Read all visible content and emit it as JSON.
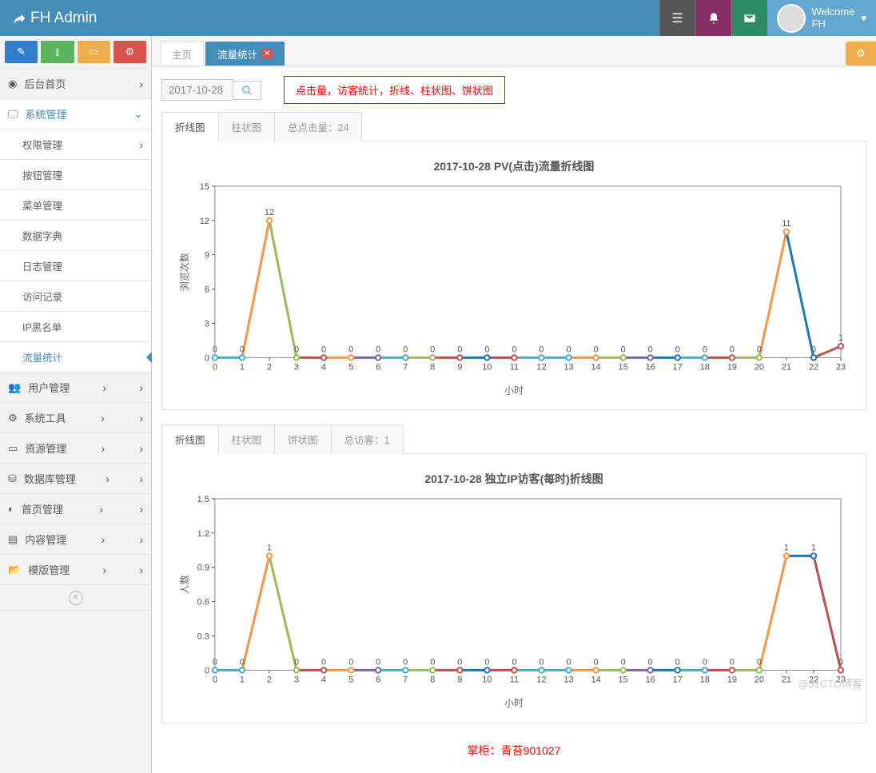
{
  "brand": "FH Admin",
  "welcome": {
    "label": "Welcome",
    "name": "FH"
  },
  "sidebar": {
    "items": [
      {
        "label": "后台首页"
      },
      {
        "label": "系统管理",
        "open": true,
        "children": [
          {
            "label": "权限管理",
            "arr": true
          },
          {
            "label": "按钮管理"
          },
          {
            "label": "菜单管理"
          },
          {
            "label": "数据字典"
          },
          {
            "label": "日志管理"
          },
          {
            "label": "访问记录"
          },
          {
            "label": "IP黑名单"
          },
          {
            "label": "流量统计",
            "active": true
          }
        ]
      },
      {
        "label": "用户管理"
      },
      {
        "label": "系统工具"
      },
      {
        "label": "资源管理"
      },
      {
        "label": "数据库管理"
      },
      {
        "label": "首页管理"
      },
      {
        "label": "内容管理"
      },
      {
        "label": "模版管理"
      }
    ]
  },
  "tabs": {
    "home": "主页",
    "active": "流量统计"
  },
  "date": "2017-10-28",
  "redbox": "点击量，访客统计，折线、柱状图、饼状图",
  "chart1": {
    "tabs": [
      "折线图",
      "柱状图"
    ],
    "total": "总点击量：24"
  },
  "chart2": {
    "tabs": [
      "折线图",
      "柱状图",
      "饼状图"
    ],
    "total": "总访客：1"
  },
  "footer": "掌柜：青苔901027",
  "watermark": "@51CTO博客",
  "chart_data": [
    {
      "type": "line",
      "title": "2017-10-28  PV(点击)流量折线图",
      "xlabel": "小时",
      "ylabel": "浏览次数",
      "categories": [
        "0",
        "1",
        "2",
        "3",
        "4",
        "5",
        "6",
        "7",
        "8",
        "9",
        "10",
        "11",
        "12",
        "13",
        "14",
        "15",
        "16",
        "17",
        "18",
        "19",
        "20",
        "21",
        "22",
        "23"
      ],
      "values": [
        0,
        0,
        12,
        0,
        0,
        0,
        0,
        0,
        0,
        0,
        0,
        0,
        0,
        0,
        0,
        0,
        0,
        0,
        0,
        0,
        0,
        11,
        0,
        1
      ],
      "ylim": [
        0,
        15
      ],
      "yticks": [
        0,
        3,
        6,
        9,
        12,
        15
      ]
    },
    {
      "type": "line",
      "title": "2017-10-28  独立IP访客(每时)折线图",
      "xlabel": "小时",
      "ylabel": "人数",
      "categories": [
        "0",
        "1",
        "2",
        "3",
        "4",
        "5",
        "6",
        "7",
        "8",
        "9",
        "10",
        "11",
        "12",
        "13",
        "14",
        "15",
        "16",
        "17",
        "18",
        "19",
        "20",
        "21",
        "22",
        "23"
      ],
      "values": [
        0,
        0,
        1,
        0,
        0,
        0,
        0,
        0,
        0,
        0,
        0,
        0,
        0,
        0,
        0,
        0,
        0,
        0,
        0,
        0,
        0,
        1,
        1,
        0
      ],
      "ylim": [
        0,
        1.5
      ],
      "yticks": [
        0,
        0.3,
        0.6,
        0.9,
        1.2,
        1.5
      ]
    }
  ],
  "seg_colors": [
    "#4bacc6",
    "#f79646",
    "#9bbb59",
    "#c0504d",
    "#f79646",
    "#8064a2",
    "#4bacc6",
    "#9bbb59",
    "#c0504d",
    "#1f77b4",
    "#c0504d",
    "#4bacc6",
    "#4bacc6",
    "#f79646",
    "#9bbb59",
    "#8064a2",
    "#1f77b4",
    "#4bacc6",
    "#c0504d",
    "#9bbb59",
    "#f79646",
    "#1f77b4",
    "#c0504d"
  ]
}
